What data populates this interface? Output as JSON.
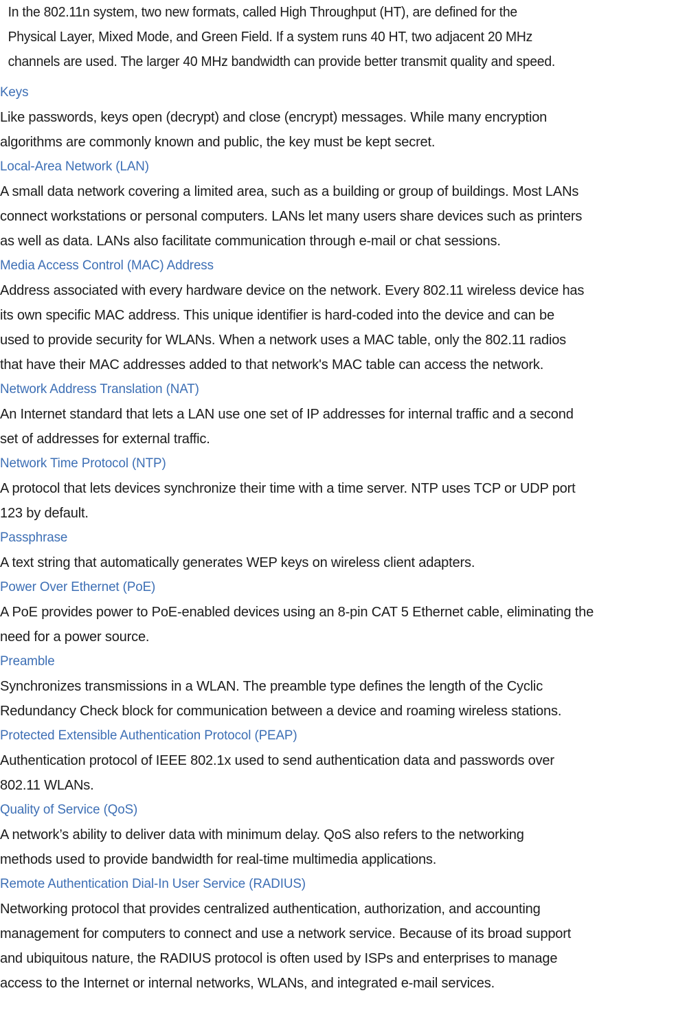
{
  "document": {
    "intro_paragraph": {
      "lines": [
        "In the 802.11n system, two new formats, called High Throughput (HT), are defined  for the",
        "Physical Layer, Mixed  Mode,  and Green Field. If a system runs  40 HT, two adjacent 20 MHz",
        "channels are used. The larger 40 MHz bandwidth  can provide  better transmit quality and speed."
      ]
    },
    "heading_color": "#3d6fb5",
    "body_color": "#1b1b1b",
    "entries": [
      {
        "term": "Keys",
        "definition_lines": [
          "Like passwords, keys open  (decrypt) and  close  (encrypt)   messages. While  many  encryption",
          "algorithms are commonly  known  and public, the key must be kept secret."
        ]
      },
      {
        "term": "Local-Area Network (LAN)",
        "definition_lines": [
          "A small data network covering  a limited area, such as a building  or group of buildings. Most LANs",
          "connect  workstations  or personal computers.  LANs let  many  users share devices  such as printers",
          "as well as data. LANs also facilitate communication through e-mail or chat sessions."
        ]
      },
      {
        "term": "Media Access Control (MAC) Address",
        "definition_lines": [
          "Address associated with every hardware  device on the network.  Every 802.11  wireless  device  has",
          "its own  specific  MAC address.  This unique identifier  is hard-coded   into the device and can be",
          "used to provide security for WLANs. When  a network uses a MAC table, only the 802.11 radios",
          "that have their MAC addresses added  to that network's MAC table can access the network."
        ]
      },
      {
        "term": "Network Address Translation (NAT)",
        "definition_lines": [
          "An Internet standard that lets a LAN use one  set of IP addresses   for internal traffic and  a second",
          "set of addresses for external traffic."
        ]
      },
      {
        "term": "Network Time Protocol (NTP)",
        "definition_lines": [
          "A protocol that lets devices synchronize  their time with a time server.  NTP uses TCP or UDP port",
          "123 by default."
        ]
      },
      {
        "term": "Passphrase",
        "definition_lines": [
          "A text string that automatically generates WEP keys on wireless client adapters."
        ]
      },
      {
        "term": "Power Over Ethernet (PoE)",
        "definition_lines": [
          "A PoE provides power  to PoE-enabled devices using an 8-pin  CAT 5 Ethernet cable, eliminating the",
          "need for a power  source."
        ]
      },
      {
        "term": "Preamble",
        "definition_lines": [
          "Synchronizes transmissions in a WLAN. The preamble  type defines the length of the Cyclic",
          "Redundancy  Check block  for communication between a device and roaming  wireless stations."
        ]
      },
      {
        "term": "Protected Extensible Authentication Protocol (PEAP)",
        "definition_lines": [
          "Authentication protocol of IEEE 802.1x used to send authentication data and passwords over",
          "802.11 WLANs."
        ]
      },
      {
        "term": "Quality of Service (QoS)",
        "definition_lines": [
          "A network’s ability to deliver data with minimum  delay. QoS also refers to the networking",
          "methods used to provide bandwidth for real-time multimedia applications."
        ]
      },
      {
        "term": "Remote Authentication Dial-In  User Service (RADIUS)",
        "definition_lines": [
          "Networking protocol that provides centralized authentication, authorization, and accounting",
          "management for computers to connect and use a network service.  Because of its broad support",
          "and ubiquitous nature, the RADIUS protocol is often used  by  ISPs and  enterprises to manage",
          "access to the Internet or internal networks, WLANs, and integrated e-mail services."
        ]
      }
    ]
  }
}
